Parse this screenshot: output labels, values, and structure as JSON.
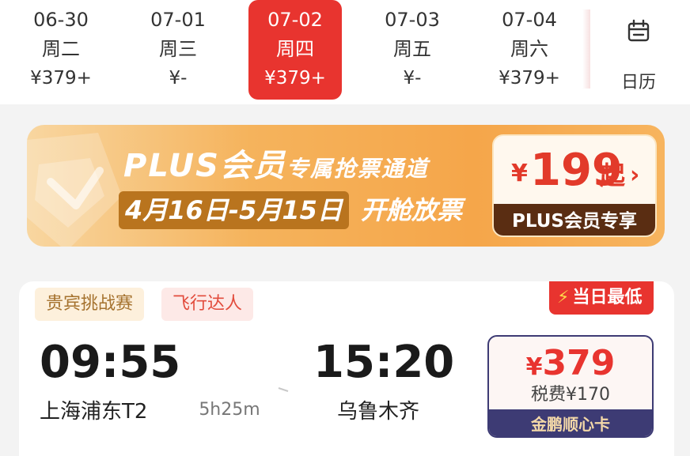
{
  "date_strip": {
    "dates": [
      {
        "date": "06-30",
        "weekday": "周二",
        "price": "¥379+",
        "selected": false
      },
      {
        "date": "07-01",
        "weekday": "周三",
        "price": "¥-",
        "selected": false
      },
      {
        "date": "07-02",
        "weekday": "周四",
        "price": "¥379+",
        "selected": true
      },
      {
        "date": "07-03",
        "weekday": "周五",
        "price": "¥-",
        "selected": false
      },
      {
        "date": "07-04",
        "weekday": "周六",
        "price": "¥379+",
        "selected": false
      }
    ],
    "calendar_label": "日历",
    "calendar_icon": "calendar-icon",
    "selected_color": "#e8342f"
  },
  "plus_banner": {
    "title": "PLUS会员",
    "subtitle": "专属抢票通道",
    "date_range": "4月16日-5月15日",
    "date_suffix": "开舱放票",
    "price_currency": "¥",
    "price_amount": "199",
    "price_suffix": "起",
    "price_chevron": "›",
    "badge": "PLUS会员专享"
  },
  "flight": {
    "tags": [
      "贵宾挑战赛",
      "飞行达人"
    ],
    "lowest_badge": "当日最低",
    "lowest_icon": "lightning-icon",
    "departure_time": "09:55",
    "arrival_time": "15:20",
    "departure_city": "上海浦东T2",
    "arrival_city": "乌鲁木齐",
    "duration": "5h25m",
    "price_currency": "¥",
    "price_amount": "379",
    "tax": "税费¥170",
    "card_label": "金鹏顺心卡",
    "accent_color": "#e8342f",
    "card_color": "#3d3b74"
  }
}
